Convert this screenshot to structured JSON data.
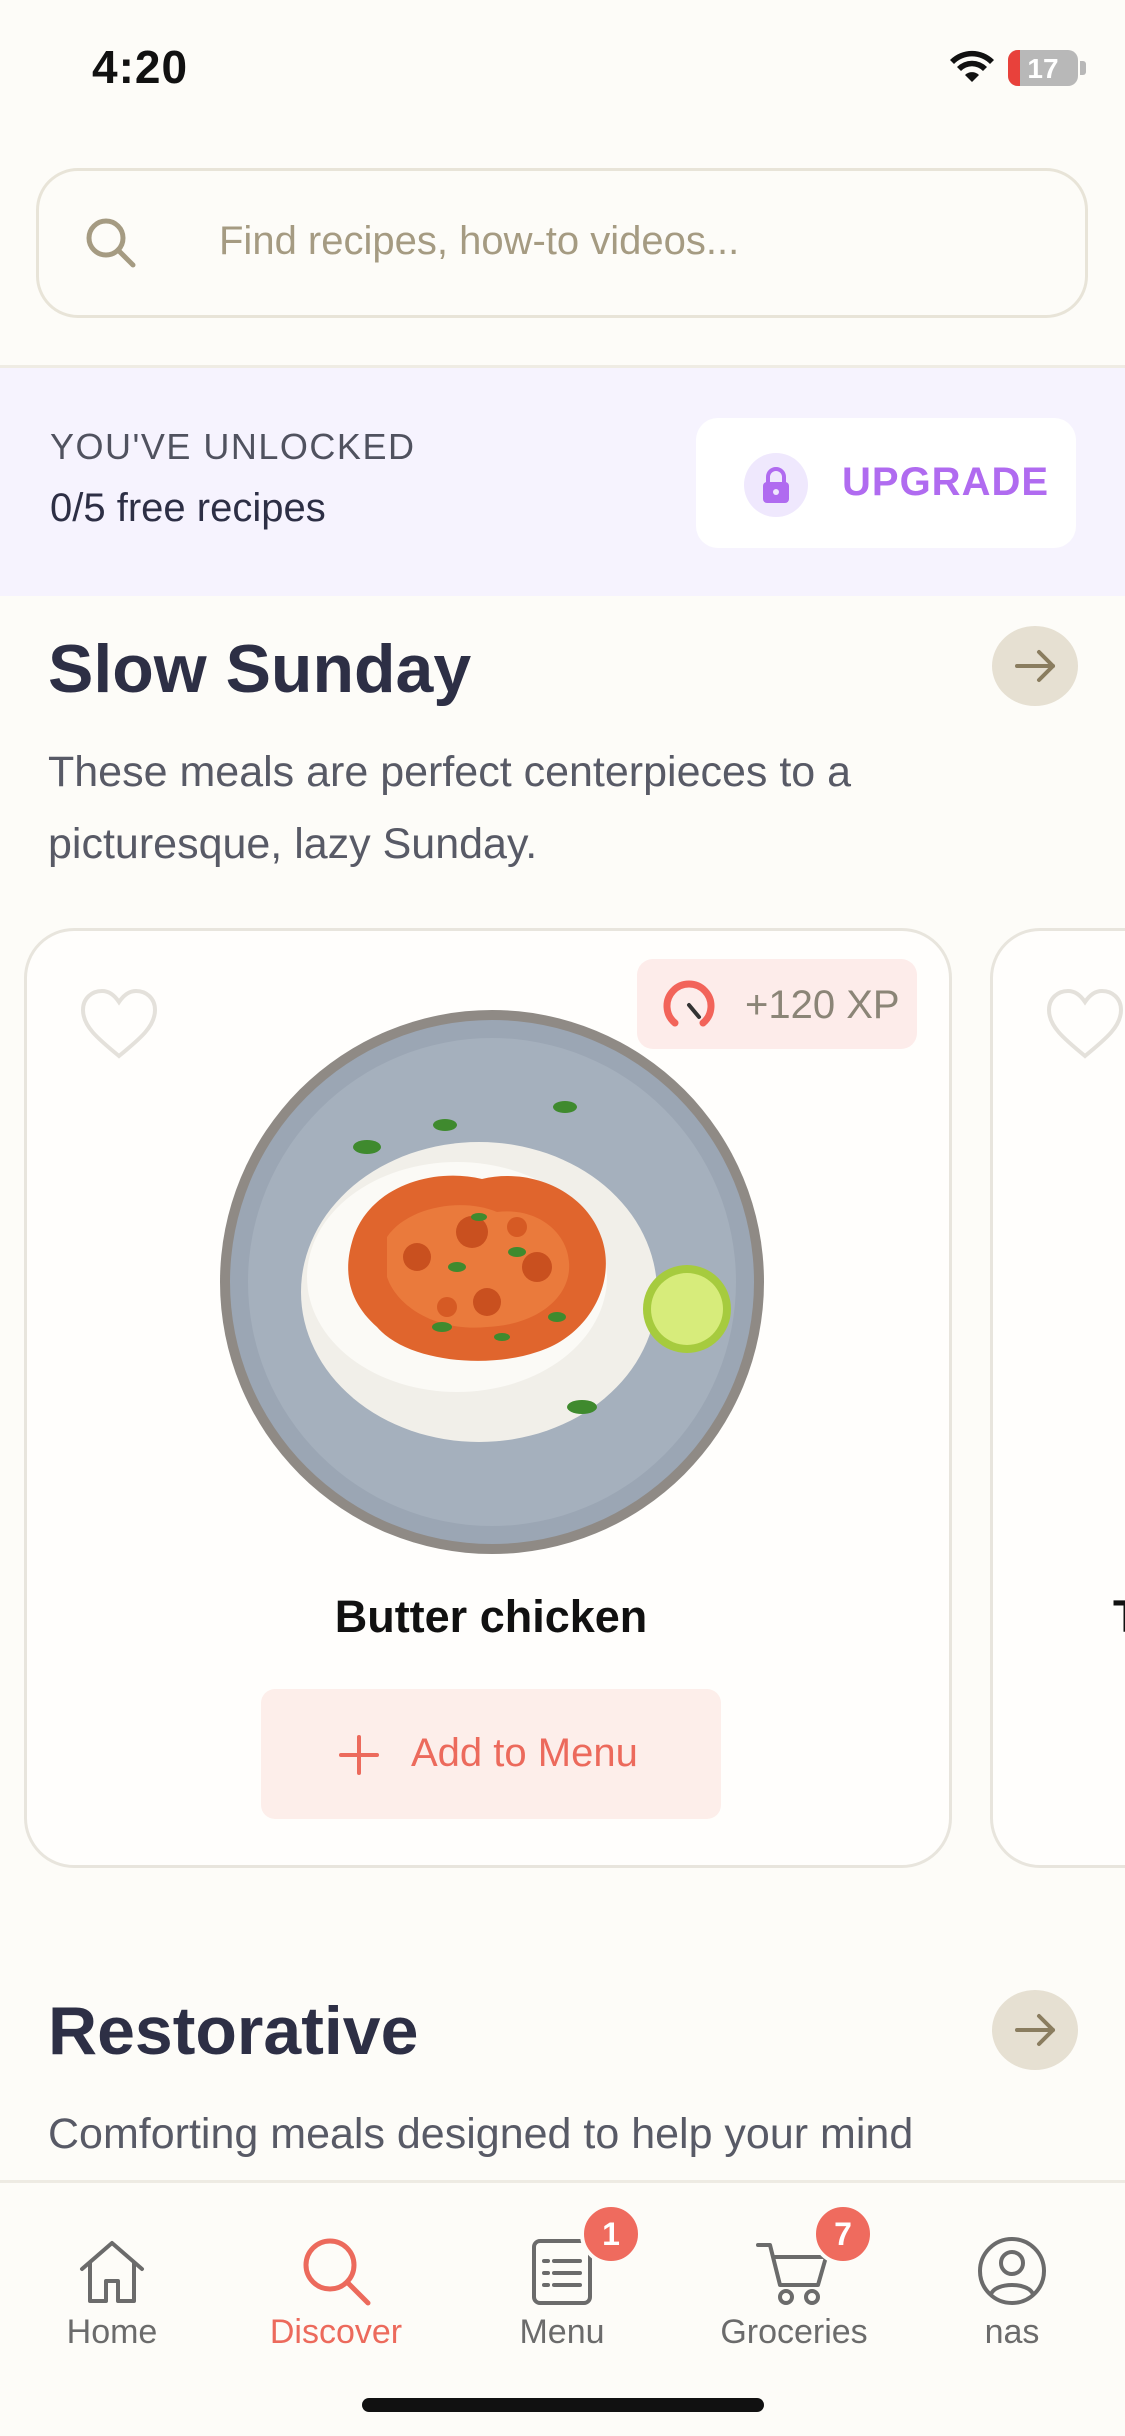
{
  "status_bar": {
    "time": "4:20",
    "battery": "17",
    "battery_level": 0.17
  },
  "search": {
    "placeholder": "Find recipes, how-to videos..."
  },
  "unlock_banner": {
    "title": "YOU'VE UNLOCKED",
    "count_text": "0/5 free recipes",
    "upgrade_label": "UPGRADE"
  },
  "sections": [
    {
      "title": "Slow Sunday",
      "description": "These meals are perfect centerpieces to a picturesque, lazy Sunday."
    },
    {
      "title": "Restorative",
      "description": "Comforting meals designed to help your mind"
    }
  ],
  "recipes": [
    {
      "name": "Butter chicken",
      "xp": "+120 XP",
      "favorited": false,
      "add_label": "Add to Menu"
    },
    {
      "name": "T",
      "favorited": false
    }
  ],
  "bottom_nav": {
    "items": [
      {
        "label": "Home",
        "icon": "home-icon",
        "active": false
      },
      {
        "label": "Discover",
        "icon": "search-icon",
        "active": true
      },
      {
        "label": "Menu",
        "icon": "menu-list-icon",
        "badge": "1",
        "active": false
      },
      {
        "label": "Groceries",
        "icon": "cart-icon",
        "badge": "7",
        "active": false
      },
      {
        "label": "nas",
        "icon": "profile-icon",
        "active": false
      }
    ]
  },
  "colors": {
    "background": "#fdfcf8",
    "accent_coral": "#ec6a5c",
    "upgrade_purple": "#b06bf0",
    "banner_background": "#f6f3fe",
    "text_dark": "#2d2f45"
  }
}
